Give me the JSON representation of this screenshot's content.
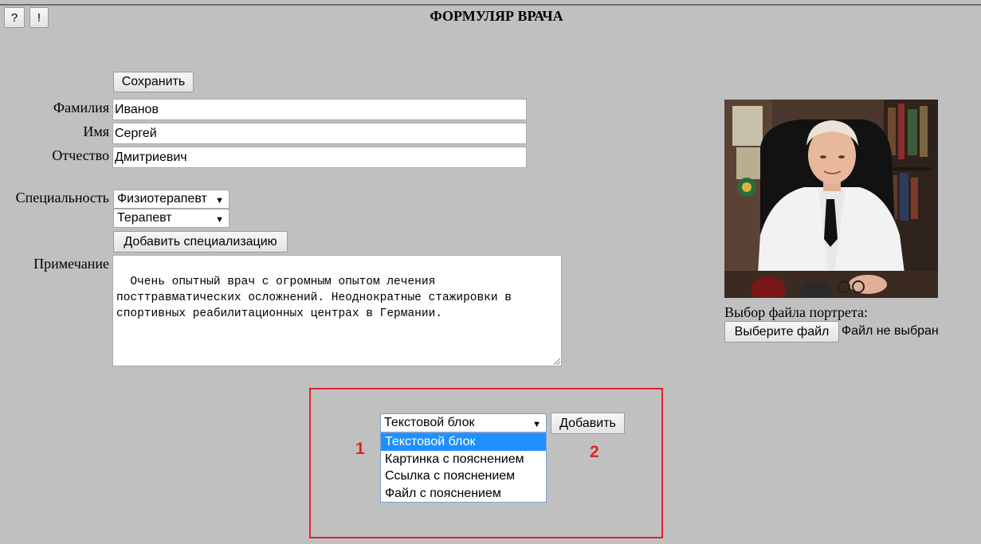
{
  "toolbar": {
    "help_label": "?",
    "info_label": "!"
  },
  "page": {
    "title": "ФОРМУЛЯР ВРАЧА"
  },
  "form": {
    "save_label": "Сохранить",
    "surname": {
      "label": "Фамилия",
      "value": "Иванов"
    },
    "name": {
      "label": "Имя",
      "value": "Сергей"
    },
    "patronymic": {
      "label": "Отчество",
      "value": "Дмитриевич"
    },
    "specialty": {
      "label": "Специальность",
      "selects": [
        "Физиотерапевт",
        "Терапевт"
      ],
      "add_label": "Добавить специализацию"
    },
    "note": {
      "label": "Примечание",
      "value": "Очень опытный врач с огромным опытом лечения\nпосттравматических осложнений. Неоднократные стажировки в\nспортивных реабилитационных центрах в Германии."
    }
  },
  "portrait": {
    "choose_label": "Выбор файла портрета:",
    "file_button": "Выберите файл",
    "file_status": "Файл не выбран"
  },
  "block_adder": {
    "selected": "Текстовой блок",
    "options": [
      "Текстовой блок",
      "Картинка с пояснением",
      "Ссылка с пояснением",
      "Файл с пояснением"
    ],
    "add_label": "Добавить",
    "marker_1": "1",
    "marker_2": "2"
  },
  "colors": {
    "background": "#c0c0c0",
    "annotation_red": "#e0222c",
    "selection_blue": "#1e90ff"
  }
}
